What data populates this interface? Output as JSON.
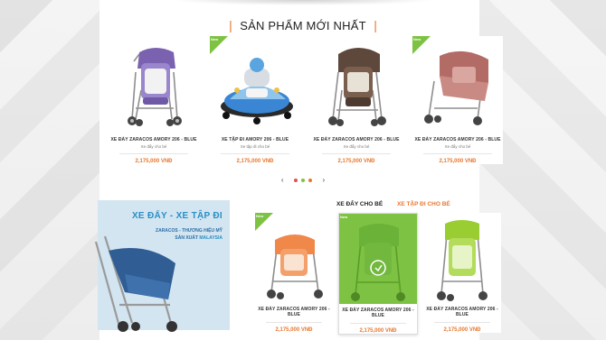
{
  "section": {
    "title": "SẢN PHẨM MỚI NHẤT"
  },
  "badges": {
    "new": "New"
  },
  "top_products": [
    {
      "name": "XE ĐẨY ZARACOS AMORY 206 - BLUE",
      "category": "Xe đẩy cho bé",
      "price": "2,175,000 VNĐ",
      "new": false,
      "color": "#8a6fb8"
    },
    {
      "name": "XE TẬP ĐI AMORY 206 - BLUE",
      "category": "Xe tập đi cho bé",
      "price": "2,175,000 VNĐ",
      "new": true,
      "color": "#5b9fdc"
    },
    {
      "name": "XE ĐẨY ZARACOS AMORY 206 - BLUE",
      "category": "Xe đẩy cho bé",
      "price": "2,175,000 VNĐ",
      "new": false,
      "color": "#6d5447"
    },
    {
      "name": "XE ĐẨY ZARACOS AMORY 206 - BLUE",
      "category": "Xe đẩy cho bé",
      "price": "2,175,000 VNĐ",
      "new": true,
      "color": "#b86f6a"
    }
  ],
  "pager": {
    "prev": "‹",
    "next": "›",
    "dots": [
      "#d9534f",
      "#7dc242",
      "#e8772e"
    ]
  },
  "banner": {
    "title": "XE ĐẨY - XE TẬP ĐI",
    "line1": "ZARACOS - THƯƠNG HIỆU MỸ",
    "line2_a": "SẢN XUẤT ",
    "line2_b": "MALAYSIA"
  },
  "tabs": {
    "stroller": "XE ĐẨY CHO BÉ",
    "walker": "XE TẬP ĐI CHO BÉ"
  },
  "bottom_products": [
    {
      "name": "XE ĐẨY ZARACOS AMORY 206 - BLUE",
      "price": "2,175,000 VNĐ",
      "new": true,
      "color": "#f0884a"
    },
    {
      "name": "XE ĐẨY ZARACOS AMORY 206 - BLUE",
      "price": "2,175,000 VNĐ",
      "new": true,
      "color": "#7dc242"
    },
    {
      "name": "XE ĐẨY ZARACOS AMORY 206 - BLUE",
      "price": "2,175,000 VNĐ",
      "new": false,
      "color": "#9acd32"
    }
  ],
  "colors": {
    "accent": "#e8772e",
    "new_badge": "#7dc242",
    "banner_bg": "#d3e5f1",
    "banner_text": "#2a8fc6"
  }
}
